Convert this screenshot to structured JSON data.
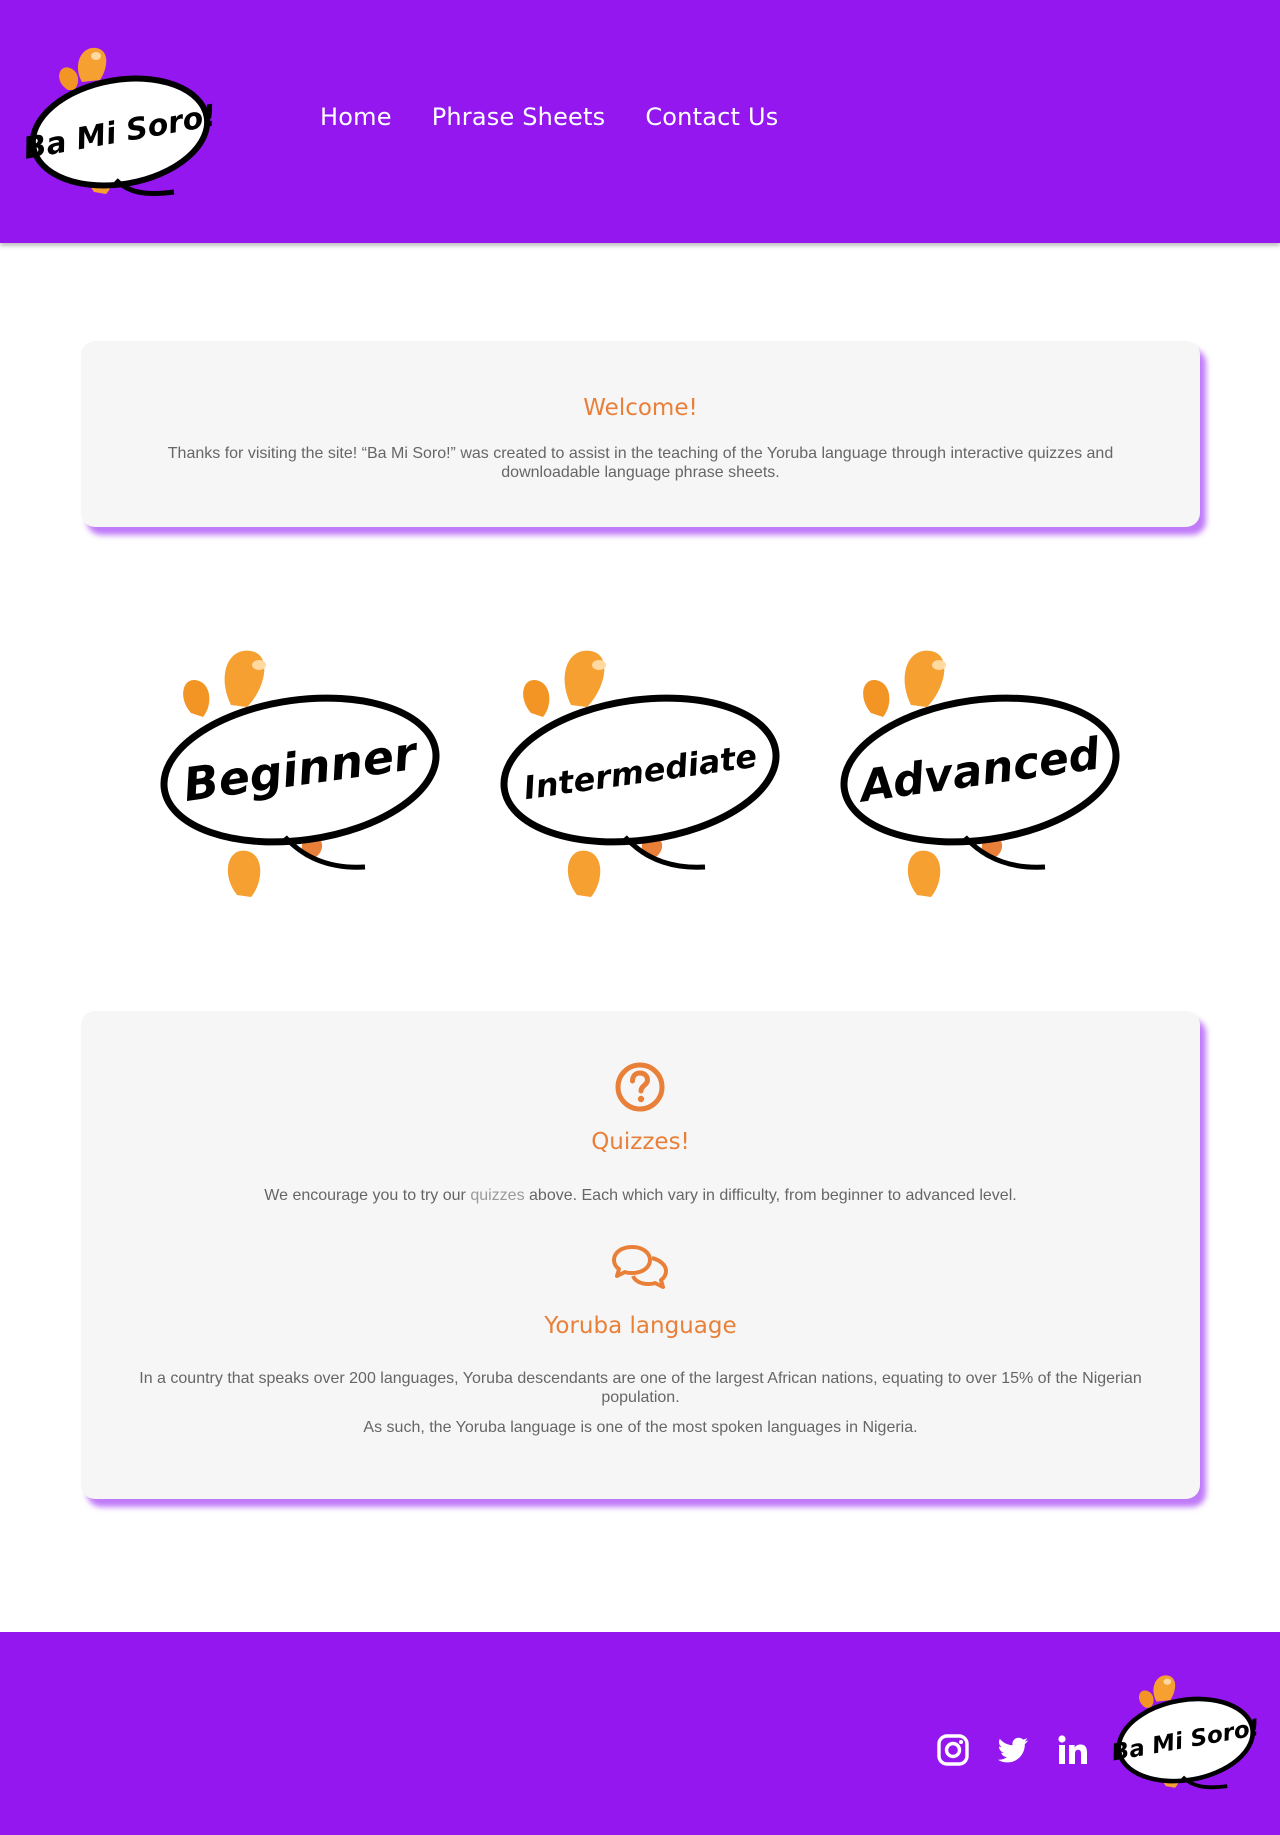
{
  "brand": {
    "name": "Ba Mi Soro!",
    "colors": {
      "primary": "#9517f0",
      "accent": "#e9803a",
      "card": "#f6f6f6"
    }
  },
  "nav": {
    "items": [
      {
        "label": "Home"
      },
      {
        "label": "Phrase Sheets"
      },
      {
        "label": "Contact Us"
      }
    ]
  },
  "welcome": {
    "title": "Welcome!",
    "text": "Thanks for visiting the site! “Ba Mi Soro!” was created to assist in the teaching of the Yoruba language through interactive quizzes and downloadable language phrase sheets."
  },
  "levels": [
    {
      "label": "Beginner"
    },
    {
      "label": "Intermediate"
    },
    {
      "label": "Advanced"
    }
  ],
  "quizzes": {
    "icon": "question-circle-icon",
    "title": "Quizzes!",
    "text_before": "We encourage you to try our ",
    "link": "quizzes",
    "text_after": " above. Each which vary in difficulty, from beginner to advanced level."
  },
  "yoruba": {
    "icon": "comments-icon",
    "title": "Yoruba language",
    "paragraph1": "In a country that speaks over 200 languages, Yoruba descendants are one of the largest African nations, equating to over 15% of the Nigerian population.",
    "paragraph2": "As such, the Yoruba language is one of the most spoken languages in Nigeria."
  },
  "footer": {
    "social": [
      {
        "icon": "instagram-icon"
      },
      {
        "icon": "twitter-icon"
      },
      {
        "icon": "linkedin-icon"
      }
    ]
  }
}
